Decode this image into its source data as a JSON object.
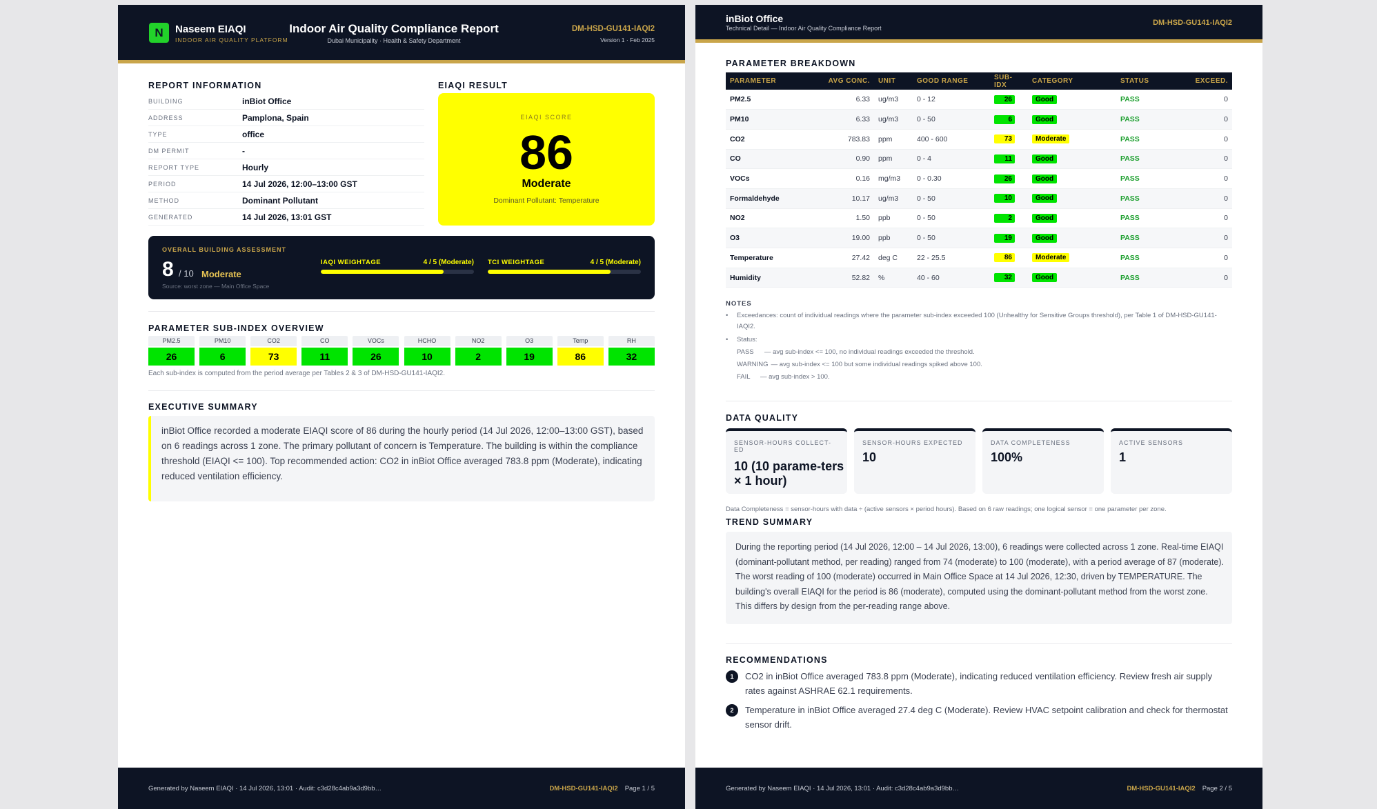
{
  "header": {
    "logo_letter": "N",
    "brand": "Naseem EIAQI",
    "brand_sub": "INDOOR AIR QUALITY PLATFORM",
    "title": "Indoor Air Quality Compliance Report",
    "subtitle": "Dubai Municipality · Health & Safety Department",
    "code": "DM-HSD-GU141-IAQI2",
    "version": "Version 1 · Feb 2025"
  },
  "report_info": {
    "title": "REPORT INFORMATION",
    "rows": [
      {
        "label": "BUILDING",
        "value": "inBiot Office"
      },
      {
        "label": "ADDRESS",
        "value": "Pamplona, Spain"
      },
      {
        "label": "TYPE",
        "value": "office"
      },
      {
        "label": "DM PERMIT",
        "value": "-"
      },
      {
        "label": "REPORT TYPE",
        "value": "Hourly"
      },
      {
        "label": "PERIOD",
        "value": "14 Jul 2026, 12:00–13:00 GST"
      },
      {
        "label": "METHOD",
        "value": "Dominant Pollutant"
      },
      {
        "label": "GENERATED",
        "value": "14 Jul 2026, 13:01 GST"
      }
    ]
  },
  "eiaqi": {
    "section_title": "EIAQI RESULT",
    "label": "EIAQI SCORE",
    "score": "86",
    "category": "Moderate",
    "dominant": "Dominant Pollutant: Temperature",
    "color": "#ffff00"
  },
  "overall": {
    "label": "OVERALL BUILDING ASSESSMENT",
    "score": "8",
    "denominator": "/ 10",
    "category": "Moderate",
    "source": "Source: worst zone — Main Office Space",
    "weightages": [
      {
        "label": "IAQI WEIGHTAGE",
        "value": "4 / 5 (Moderate)",
        "fraction": 0.8
      },
      {
        "label": "TCI WEIGHTAGE",
        "value": "4 / 5 (Moderate)",
        "fraction": 0.8
      }
    ]
  },
  "sub_index_overview": {
    "title": "PARAMETER SUB-INDEX OVERVIEW",
    "items": [
      {
        "name": "PM2.5",
        "value": "26",
        "color": "#00e400"
      },
      {
        "name": "PM10",
        "value": "6",
        "color": "#00e400"
      },
      {
        "name": "CO2",
        "value": "73",
        "color": "#ffff00"
      },
      {
        "name": "CO",
        "value": "11",
        "color": "#00e400"
      },
      {
        "name": "VOCs",
        "value": "26",
        "color": "#00e400"
      },
      {
        "name": "HCHO",
        "value": "10",
        "color": "#00e400"
      },
      {
        "name": "NO2",
        "value": "2",
        "color": "#00e400"
      },
      {
        "name": "O3",
        "value": "19",
        "color": "#00e400"
      },
      {
        "name": "Temp",
        "value": "86",
        "color": "#ffff00"
      },
      {
        "name": "RH",
        "value": "32",
        "color": "#00e400"
      }
    ],
    "note": "Each sub-index is computed from the period average per Tables 2 & 3 of DM-HSD-GU141-IAQI2."
  },
  "executive_summary": {
    "title": "EXECUTIVE SUMMARY",
    "text": "inBiot Office recorded a moderate EIAQI score of 86 during the hourly period (14 Jul 2026, 12:00–13:00 GST), based on 6 readings across 1 zone. The primary pollutant of concern is Temperature. The building is within the compliance threshold (EIAQI <= 100). Top recommended action: CO2 in inBiot Office averaged 783.8 ppm (Moderate), indicating reduced ventilation efficiency."
  },
  "footer": {
    "left": "Generated by Naseem EIAQI · 14 Jul 2026, 13:01 · Audit: c3d28c4ab9a3d9bb…",
    "code": "DM-HSD-GU141-IAQI2",
    "page1": "Page 1 / 5",
    "page2": "Page 2 / 5"
  },
  "page2_header": {
    "title": "inBiot Office",
    "subtitle": "Technical Detail — Indoor Air Quality Compliance Report",
    "code": "DM-HSD-GU141-IAQI2"
  },
  "parameter_breakdown": {
    "title": "PARAMETER BREAKDOWN",
    "columns": [
      "PARAMETER",
      "AVG CONC.",
      "UNIT",
      "GOOD RANGE",
      "SUB-IDX",
      "CATEGORY",
      "STATUS",
      "EXCEED."
    ],
    "rows": [
      {
        "parameter": "PM2.5",
        "avg": "6.33",
        "unit": "ug/m3",
        "range": "0 - 12",
        "subidx": "26",
        "category": "Good",
        "color": "#00e400",
        "status": "PASS",
        "exceed": "0"
      },
      {
        "parameter": "PM10",
        "avg": "6.33",
        "unit": "ug/m3",
        "range": "0 - 50",
        "subidx": "6",
        "category": "Good",
        "color": "#00e400",
        "status": "PASS",
        "exceed": "0"
      },
      {
        "parameter": "CO2",
        "avg": "783.83",
        "unit": "ppm",
        "range": "400 - 600",
        "subidx": "73",
        "category": "Moderate",
        "color": "#ffff00",
        "status": "PASS",
        "exceed": "0"
      },
      {
        "parameter": "CO",
        "avg": "0.90",
        "unit": "ppm",
        "range": "0 - 4",
        "subidx": "11",
        "category": "Good",
        "color": "#00e400",
        "status": "PASS",
        "exceed": "0"
      },
      {
        "parameter": "VOCs",
        "avg": "0.16",
        "unit": "mg/m3",
        "range": "0 - 0.30",
        "subidx": "26",
        "category": "Good",
        "color": "#00e400",
        "status": "PASS",
        "exceed": "0"
      },
      {
        "parameter": "Formaldehyde",
        "avg": "10.17",
        "unit": "ug/m3",
        "range": "0 - 50",
        "subidx": "10",
        "category": "Good",
        "color": "#00e400",
        "status": "PASS",
        "exceed": "0"
      },
      {
        "parameter": "NO2",
        "avg": "1.50",
        "unit": "ppb",
        "range": "0 - 50",
        "subidx": "2",
        "category": "Good",
        "color": "#00e400",
        "status": "PASS",
        "exceed": "0"
      },
      {
        "parameter": "O3",
        "avg": "19.00",
        "unit": "ppb",
        "range": "0 - 50",
        "subidx": "19",
        "category": "Good",
        "color": "#00e400",
        "status": "PASS",
        "exceed": "0"
      },
      {
        "parameter": "Temperature",
        "avg": "27.42",
        "unit": "deg C",
        "range": "22 - 25.5",
        "subidx": "86",
        "category": "Moderate",
        "color": "#ffff00",
        "status": "PASS",
        "exceed": "0"
      },
      {
        "parameter": "Humidity",
        "avg": "52.82",
        "unit": "%",
        "range": "40 - 60",
        "subidx": "32",
        "category": "Good",
        "color": "#00e400",
        "status": "PASS",
        "exceed": "0"
      }
    ]
  },
  "notes": {
    "title": "NOTES",
    "bullet": "•",
    "exceed_note": "Exceedances: count of individual readings where the parameter sub-index exceeded 100 (Unhealthy for Sensitive Groups threshold), per Table 1 of DM-HSD-GU141-IAQI2.",
    "status_label": "Status:",
    "status_lines": [
      {
        "key": "PASS",
        "text": "— avg sub-index <= 100, no individual readings exceeded the threshold."
      },
      {
        "key": "WARNING",
        "text": "— avg sub-index <= 100 but some individual readings spiked above 100."
      },
      {
        "key": "FAIL",
        "text": "— avg sub-index > 100."
      }
    ]
  },
  "data_quality": {
    "title": "DATA QUALITY",
    "cards": [
      {
        "label": "SENSOR-HOURS COLLECT-ED",
        "value": "10 (10 parame-ters × 1 hour)"
      },
      {
        "label": "SENSOR-HOURS EXPECTED",
        "value": "10"
      },
      {
        "label": "DATA COMPLETENESS",
        "value": "100%"
      },
      {
        "label": "ACTIVE SENSORS",
        "value": "1"
      }
    ],
    "note": "Data Completeness = sensor-hours with data ÷ (active sensors × period hours). Based on 6 raw readings; one logical sensor = one parameter per zone."
  },
  "trend_summary": {
    "title": "TREND SUMMARY",
    "text": "During the reporting period (14 Jul 2026, 12:00 – 14 Jul 2026, 13:00), 6 readings were collected across 1 zone. Real-time EIAQI (dominant-pollutant method, per reading) ranged from 74 (moderate) to 100 (moderate), with a period average of 87 (moderate). The worst reading of 100 (moderate) occurred in Main Office Space at 14 Jul 2026, 12:30, driven by TEMPERATURE. The building's overall EIAQI for the period is 86 (moderate), computed using the dominant-pollutant method from the worst zone. This differs by design from the per-reading range above."
  },
  "recommendations": {
    "title": "RECOMMENDATIONS",
    "items": [
      {
        "num": "1",
        "text": "CO2 in inBiot Office averaged 783.8 ppm (Moderate), indicating reduced ventilation efficiency. Review fresh air supply rates against ASHRAE 62.1 requirements."
      },
      {
        "num": "2",
        "text": "Temperature in inBiot Office averaged 27.4 deg C (Moderate). Review HVAC setpoint calibration and check for thermostat sensor drift."
      }
    ]
  }
}
